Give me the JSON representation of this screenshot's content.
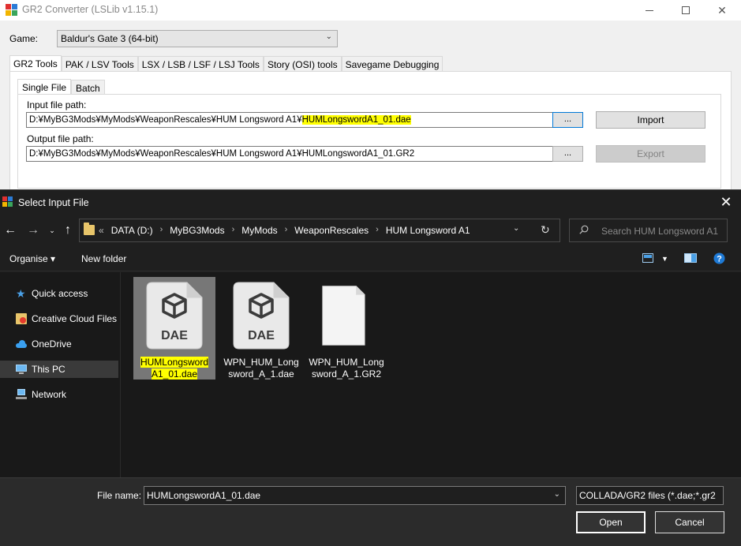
{
  "app": {
    "title": "GR2 Converter (LSLib v1.15.1)",
    "game_label": "Game:",
    "game_value": "Baldur's Gate 3 (64-bit)",
    "tabs": [
      "GR2 Tools",
      "PAK / LSV Tools",
      "LSX / LSB / LSF / LSJ Tools",
      "Story (OSI) tools",
      "Savegame Debugging"
    ],
    "subtabs": [
      "Single File",
      "Batch"
    ],
    "input_label": "Input file path:",
    "input_path_prefix": "D:¥MyBG3Mods¥MyMods¥WeaponRescales¥HUM Longsword A1¥",
    "input_path_highlight": "HUMLongswordA1_01.dae",
    "output_label": "Output file path:",
    "output_path": "D:¥MyBG3Mods¥MyMods¥WeaponRescales¥HUM Longsword A1¥HUMLongswordA1_01.GR2",
    "browse_label": "...",
    "import_label": "Import",
    "export_label": "Export"
  },
  "dialog": {
    "title": "Select Input File",
    "breadcrumb_prefix": "«",
    "breadcrumbs": [
      "DATA (D:)",
      "MyBG3Mods",
      "MyMods",
      "WeaponRescales",
      "HUM Longsword A1"
    ],
    "search_placeholder": "Search HUM Longsword A1",
    "organise_label": "Organise ▾",
    "new_folder_label": "New folder",
    "sidebar": [
      {
        "label": "Quick access",
        "icon": "star-icon"
      },
      {
        "label": "Creative Cloud Files",
        "icon": "creative-cloud-icon"
      },
      {
        "label": "OneDrive",
        "icon": "cloud-icon"
      },
      {
        "label": "This PC",
        "icon": "computer-icon",
        "selected": true
      },
      {
        "label": "Network",
        "icon": "network-icon"
      }
    ],
    "files": [
      {
        "line1": "HUMLongsword",
        "line2": "A1_01.dae",
        "badge": "DAE",
        "selected": true
      },
      {
        "line1": "WPN_HUM_Long",
        "line2": "sword_A_1.dae",
        "badge": "DAE",
        "selected": false
      },
      {
        "line1": "WPN_HUM_Long",
        "line2": "sword_A_1.GR2",
        "badge": "",
        "selected": false
      }
    ],
    "file_name_label": "File name:",
    "file_name_value": "HUMLongswordA1_01.dae",
    "file_type": "COLLADA/GR2 files (*.dae;*.gr2",
    "open_label": "Open",
    "cancel_label": "Cancel"
  },
  "colors": {
    "highlight": "#ffff00",
    "dialog_bg": "#202020",
    "accent": "#0078d7"
  }
}
